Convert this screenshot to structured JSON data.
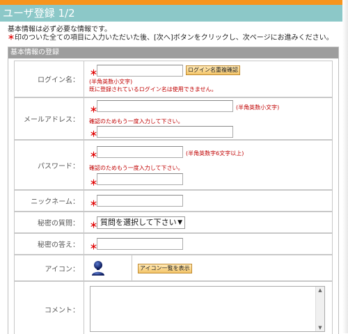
{
  "title": "ユーザ登録 1/2",
  "intro": {
    "line1": "基本情報は必ず必要な情報です。",
    "required_mark": "＊",
    "line2": "印のついた全ての項目に入力いただいた後、[次へ]ボタンをクリックし、次ページにお進みください。"
  },
  "section_header": "基本情報の登録",
  "colors": {
    "top_strip": "#f7941d",
    "title_bar": "#8cc8c8",
    "section_header": "#9d9d9d",
    "required": "#e00000"
  },
  "form": {
    "required_mark": "＊",
    "login": {
      "label": "ログイン名：",
      "check_button": "ログイン名重複確認",
      "note1": "(半角英数小文字)",
      "note2": "既に登録されているログイン名は使用できません。"
    },
    "email": {
      "label": "メールアドレス：",
      "hint": "(半角英数小文字)",
      "confirm_note": "確認のためもう一度入力して下さい。"
    },
    "password": {
      "label": "パスワード：",
      "hint": "(半角英数字6文字以上)",
      "confirm_note": "確認のためもう一度入力して下さい。"
    },
    "nickname": {
      "label": "ニックネーム："
    },
    "secret_question": {
      "label": "秘密の質問：",
      "selected": "質問を選択して下さい"
    },
    "secret_answer": {
      "label": "秘密の答え："
    },
    "icon": {
      "label": "アイコン：",
      "button": "アイコン一覧を表示",
      "icon_name": "user-silhouette-icon"
    },
    "comment": {
      "label": "コメント："
    }
  }
}
